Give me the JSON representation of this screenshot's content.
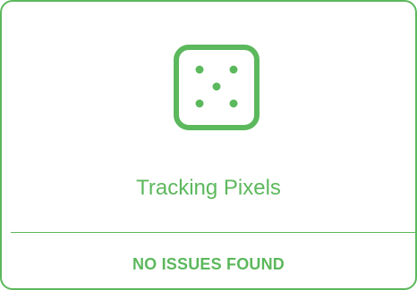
{
  "card": {
    "title": "Tracking Pixels",
    "status": "NO ISSUES FOUND",
    "icon": "dice-five-icon",
    "accent_color": "#5cb85c"
  }
}
